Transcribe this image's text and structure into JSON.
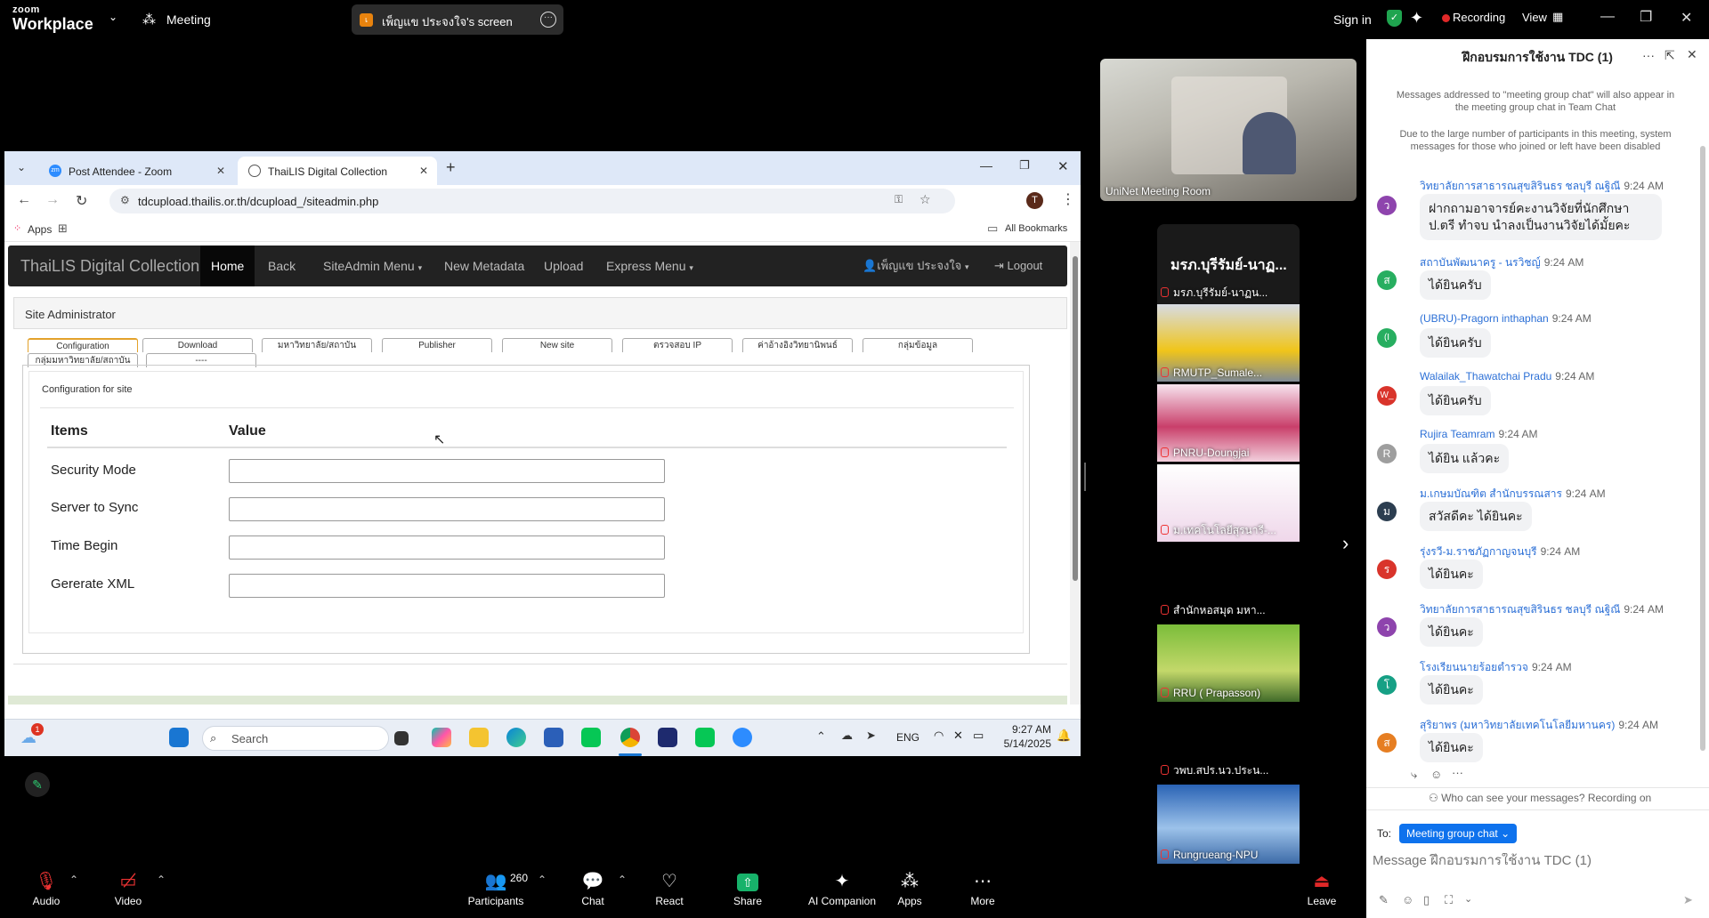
{
  "zoom": {
    "brand_top": "zoom",
    "brand_bottom": "Workplace",
    "meeting_label": "Meeting",
    "share_text": "เพ็ญแข ประจงใจ's screen",
    "share_initial": "เ",
    "sign_in": "Sign in",
    "recording": "Recording",
    "view": "View"
  },
  "browser": {
    "tabs": [
      {
        "label": "Post Attendee - Zoom"
      },
      {
        "label": "ThaiLIS Digital Collection"
      }
    ],
    "url": "tdcupload.thailis.or.th/dcupload_/siteadmin.php",
    "profile_initial": "T",
    "bookmarks": {
      "apps": "Apps",
      "all": "All Bookmarks"
    }
  },
  "site": {
    "brand": "ThaiLIS Digital Collection",
    "nav": [
      "Home",
      "Back",
      "SiteAdmin Menu",
      "New Metadata",
      "Upload",
      "Express Menu"
    ],
    "user": "เพ็ญแข ประจงใจ",
    "logout": "Logout",
    "panel_title": "Site Administrator",
    "sub_tabs": [
      "Configuration",
      "Download",
      "มหาวิทยาลัย/สถาบัน",
      "Publisher",
      "New site",
      "ตรวจสอบ IP",
      "ค่าอ้างอิงวิทยานิพนธ์",
      "กลุ่มข้อมูล",
      "กลุ่มมหาวิทยาลัย/สถาบัน",
      "----"
    ],
    "config_title": "Configuration for site",
    "table": {
      "headers": [
        "Items",
        "Value"
      ],
      "rows": [
        {
          "label": "Security Mode",
          "value": ""
        },
        {
          "label": "Server to Sync",
          "value": ""
        },
        {
          "label": "Time Begin",
          "value": ""
        },
        {
          "label": "Gererate XML",
          "value": ""
        }
      ]
    }
  },
  "taskbar": {
    "notification_count": "1",
    "search": "Search",
    "lang": "ENG",
    "time": "9:27 AM",
    "date": "5/14/2025"
  },
  "videos": {
    "main": "UniNet Meeting Room",
    "header": "มรภ.บุรีรัมย์-นาฏ...",
    "tiles": [
      "มรภ.บุรีรัมย์-นาฏน...",
      "RMUTP_Sumale...",
      "PNRU-Doungjai",
      "ม.เทคโนโลยีสุรนารี-...",
      "สำนักหอสมุด มหา...",
      "RRU ( Prapasson)",
      "วพบ.สปร.นว.ประน...",
      "Rungrueang-NPU"
    ]
  },
  "chat": {
    "title": "ฝึกอบรมการใช้งาน TDC (1)",
    "system_1": "Messages addressed to \"meeting group chat\" will also appear in the meeting group chat in Team Chat",
    "system_2": "Due to the large number of participants in this meeting, system messages for those who joined or left have been disabled",
    "messages": [
      {
        "sender": "วิทยาลัยการสาธารณสุขสิรินธร ชลบุรี ณฐิณี",
        "time": "9:24 AM",
        "text": "ฝากถามอาจารย์คะงานวิจัยที่นักศึกษา ป.ตรี ทำจบ นำลงเป็นงานวิจัยได้มั้ยคะ",
        "initial": "ว",
        "color": "#8e44ad"
      },
      {
        "sender": "สถาบันพัฒนาครู - นรวิชญ์",
        "time": "9:24 AM",
        "text": "ได้ยินครับ",
        "initial": "ส",
        "color": "#27ae60"
      },
      {
        "sender": "(UBRU)-Pragorn inthaphan",
        "time": "9:24 AM",
        "text": "ได้ยินครับ",
        "initial": "(I",
        "color": "#27ae60"
      },
      {
        "sender": "Walailak_Thawatchai Pradu",
        "time": "9:24 AM",
        "text": "ได้ยินครับ",
        "initial": "W_",
        "color": "#d9342b"
      },
      {
        "sender": "Rujira Teamram",
        "time": "9:24 AM",
        "text": "ได้ยิน แล้วคะ",
        "initial": "R",
        "color": "#9e9e9e"
      },
      {
        "sender": "ม.เกษมบัณฑิต สำนักบรรณสาร",
        "time": "9:24 AM",
        "text": "สวัสดีคะ ได้ยินคะ",
        "initial": "ม",
        "color": "#2c3e50"
      },
      {
        "sender": "รุ่งรวี-ม.ราชภัฏกาญจนบุรี",
        "time": "9:24 AM",
        "text": "ได้ยินคะ",
        "initial": "ร",
        "color": "#d9342b"
      },
      {
        "sender": "วิทยาลัยการสาธารณสุขสิรินธร ชลบุรี ณฐิณี",
        "time": "9:24 AM",
        "text": "ได้ยินคะ",
        "initial": "ว",
        "color": "#8e44ad"
      },
      {
        "sender": "โรงเรียนนายร้อยตำรวจ",
        "time": "9:24 AM",
        "text": "ได้ยินคะ",
        "initial": "โ",
        "color": "#16a085"
      },
      {
        "sender": "สุริยาพร (มหาวิทยาลัยเทคโนโลยีมหานคร)",
        "time": "9:24 AM",
        "text": "ได้ยินคะ",
        "initial": "ส",
        "color": "#e67e22"
      }
    ],
    "privacy": "Who can see your messages? Recording on",
    "to_label": "To:",
    "to_target": "Meeting group chat",
    "input_placeholder": "Message ฝึกอบรมการใช้งาน TDC (1)"
  },
  "toolbar": {
    "audio": "Audio",
    "video": "Video",
    "participants": "Participants",
    "participants_count": "260",
    "chat": "Chat",
    "react": "React",
    "share": "Share",
    "ai": "AI Companion",
    "apps": "Apps",
    "more": "More",
    "leave": "Leave"
  },
  "colors": {
    "zoom_blue": "#0e72ed",
    "share_green": "#17b26a",
    "record_red": "#e02828",
    "leave_red": "#e02828"
  }
}
